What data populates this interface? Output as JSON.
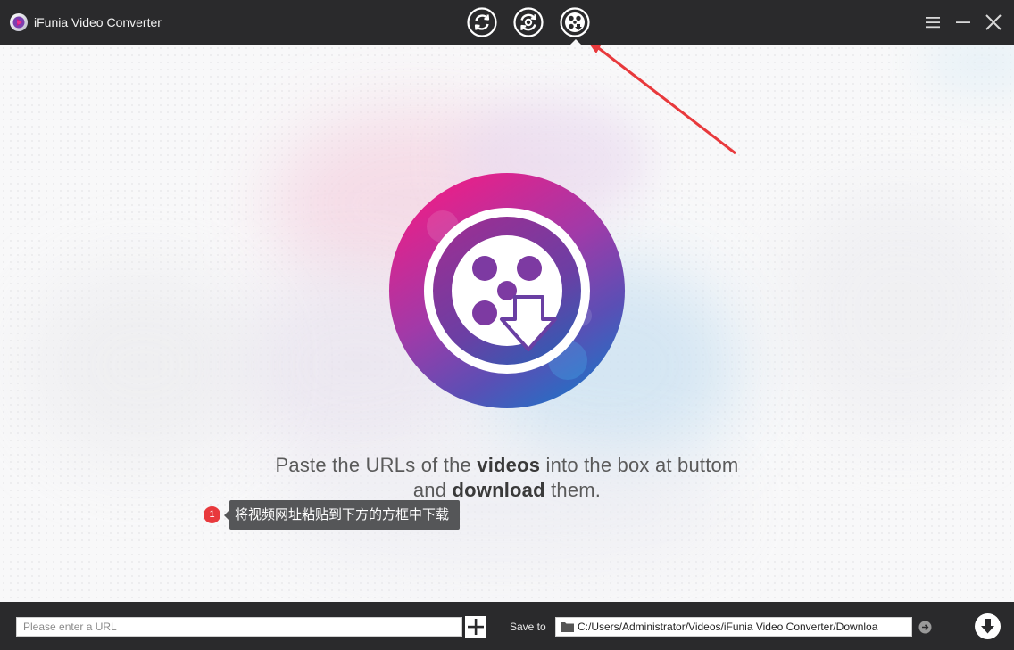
{
  "window": {
    "title": "iFunia Video Converter",
    "app_icon": "disc-play-icon",
    "mode_buttons": [
      {
        "name": "convert",
        "icon": "convert-arrows-icon"
      },
      {
        "name": "convert-loop",
        "icon": "rotate-arrows-icon"
      },
      {
        "name": "download",
        "icon": "film-reel-icon",
        "active": true
      }
    ],
    "controls": [
      "menu-icon",
      "minimize-icon",
      "close-icon"
    ]
  },
  "main": {
    "instruction": {
      "line1_a": "Paste the URLs of the ",
      "line1_b": "videos",
      "line1_c": " into the box at buttom",
      "line2_a": "and ",
      "line2_b": "download",
      "line2_c": " them."
    },
    "annotation": {
      "badge": "1",
      "tooltip": "将视频网址粘贴到下方的方框中下载",
      "arrow_color": "#e8393c"
    }
  },
  "bottom": {
    "url_input": {
      "placeholder": "Please enter a URL",
      "value": ""
    },
    "save_to_label": "Save to",
    "save_path": "C:/Users/Administrator/Videos/iFunia Video Converter/Downloa"
  },
  "colors": {
    "titlebar": "#2a2a2c",
    "accent_pink": "#e5117a",
    "accent_purple": "#7b2fa8",
    "accent_blue": "#1f6fc2",
    "annotation_red": "#e8393c"
  }
}
